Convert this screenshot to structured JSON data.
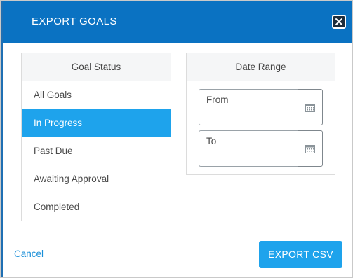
{
  "dialog": {
    "title": "EXPORT GOALS"
  },
  "colors": {
    "header": "#0a72c2",
    "accent": "#1ea3ec",
    "link": "#1a8fd8"
  },
  "goal_status": {
    "heading": "Goal Status",
    "selected": "In Progress",
    "items": [
      {
        "label": "All Goals"
      },
      {
        "label": "In Progress"
      },
      {
        "label": "Past Due"
      },
      {
        "label": "Awaiting Approval"
      },
      {
        "label": "Completed"
      }
    ]
  },
  "date_range": {
    "heading": "Date Range",
    "from_label": "From",
    "to_label": "To",
    "icon": "calendar-icon"
  },
  "footer": {
    "cancel_label": "Cancel",
    "export_label": "EXPORT CSV"
  }
}
